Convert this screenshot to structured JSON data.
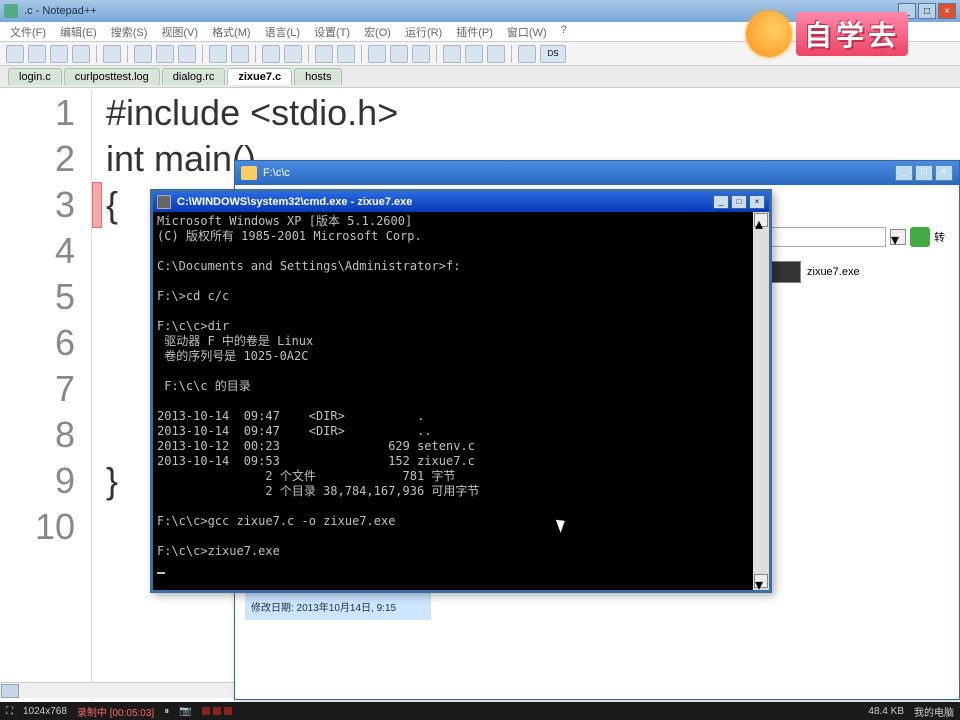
{
  "npp": {
    "title": ".c - Notepad++",
    "menus": [
      "文件(F)",
      "编辑(E)",
      "搜索(S)",
      "视图(V)",
      "格式(M)",
      "语言(L)",
      "设置(T)",
      "宏(O)",
      "运行(R)",
      "插件(P)",
      "窗口(W)",
      "?"
    ],
    "tabs": [
      "login.c",
      "curlposttest.log",
      "dialog.rc",
      "zixue7.c",
      "hosts"
    ],
    "active_tab": 3,
    "code_lines": [
      "#include <stdio.h>",
      "int main()",
      "{",
      "",
      "",
      "",
      "",
      "",
      "}",
      ""
    ]
  },
  "explorer": {
    "title": "F:\\c\\c",
    "file": "zixue7.exe",
    "info_date": "修改日期: 2013年10月14日, 9:15",
    "go_label": "转"
  },
  "cmd": {
    "title": "C:\\WINDOWS\\system32\\cmd.exe - zixue7.exe",
    "lines": [
      "Microsoft Windows XP [版本 5.1.2600]",
      "(C) 版权所有 1985-2001 Microsoft Corp.",
      "",
      "C:\\Documents and Settings\\Administrator>f:",
      "",
      "F:\\>cd c/c",
      "",
      "F:\\c\\c>dir",
      " 驱动器 F 中的卷是 Linux",
      " 卷的序列号是 1025-0A2C",
      "",
      " F:\\c\\c 的目录",
      "",
      "2013-10-14  09:47    <DIR>          .",
      "2013-10-14  09:47    <DIR>          ..",
      "2013-10-12  00:23               629 setenv.c",
      "2013-10-14  09:53               152 zixue7.c",
      "               2 个文件            781 字节",
      "               2 个目录 38,784,167,936 可用字节",
      "",
      "F:\\c\\c>gcc zixue7.c -o zixue7.exe",
      "",
      "F:\\c\\c>zixue7.exe"
    ]
  },
  "logo": {
    "text": "自学去"
  },
  "taskbar": {
    "resolution": "1024x768",
    "recording": "录制中 [00:05:03]",
    "filesize": "48.4 KB",
    "computer": "我的电脑"
  }
}
